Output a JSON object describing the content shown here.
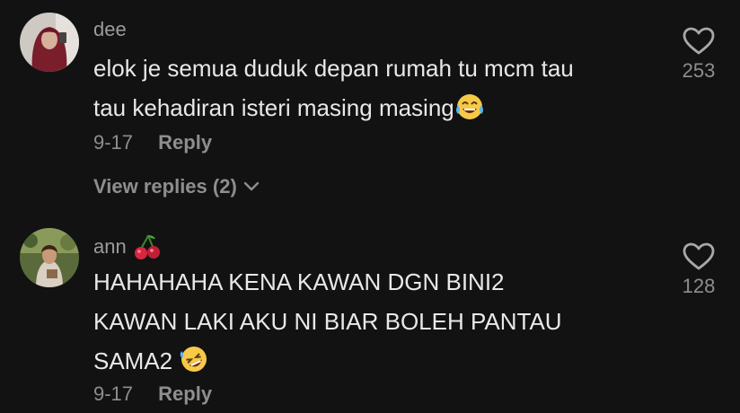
{
  "comments": [
    {
      "username": "dee",
      "username_emoji": "",
      "text_lines": [
        "elok je semua duduk depan rumah tu mcm tau",
        "tau kehadiran isteri masing masing"
      ],
      "trailing_emoji_icon": "tears-of-joy-emoji-icon",
      "date": "9-17",
      "reply_label": "Reply",
      "view_replies_label": "View replies (2)",
      "likes": "253"
    },
    {
      "username": "ann",
      "username_emoji_icon": "cherries-emoji-icon",
      "text_lines": [
        "HAHAHAHA KENA KAWAN DGN BINI2",
        "KAWAN LAKI AKU NI BIAR BOLEH PANTAU",
        "SAMA2"
      ],
      "trailing_emoji_icon": "rolling-laughing-emoji-icon",
      "date": "9-17",
      "reply_label": "Reply",
      "likes": "128"
    }
  ],
  "colors": {
    "background": "#121212",
    "text": "#e8e8e8",
    "muted": "#8e8e8e"
  }
}
